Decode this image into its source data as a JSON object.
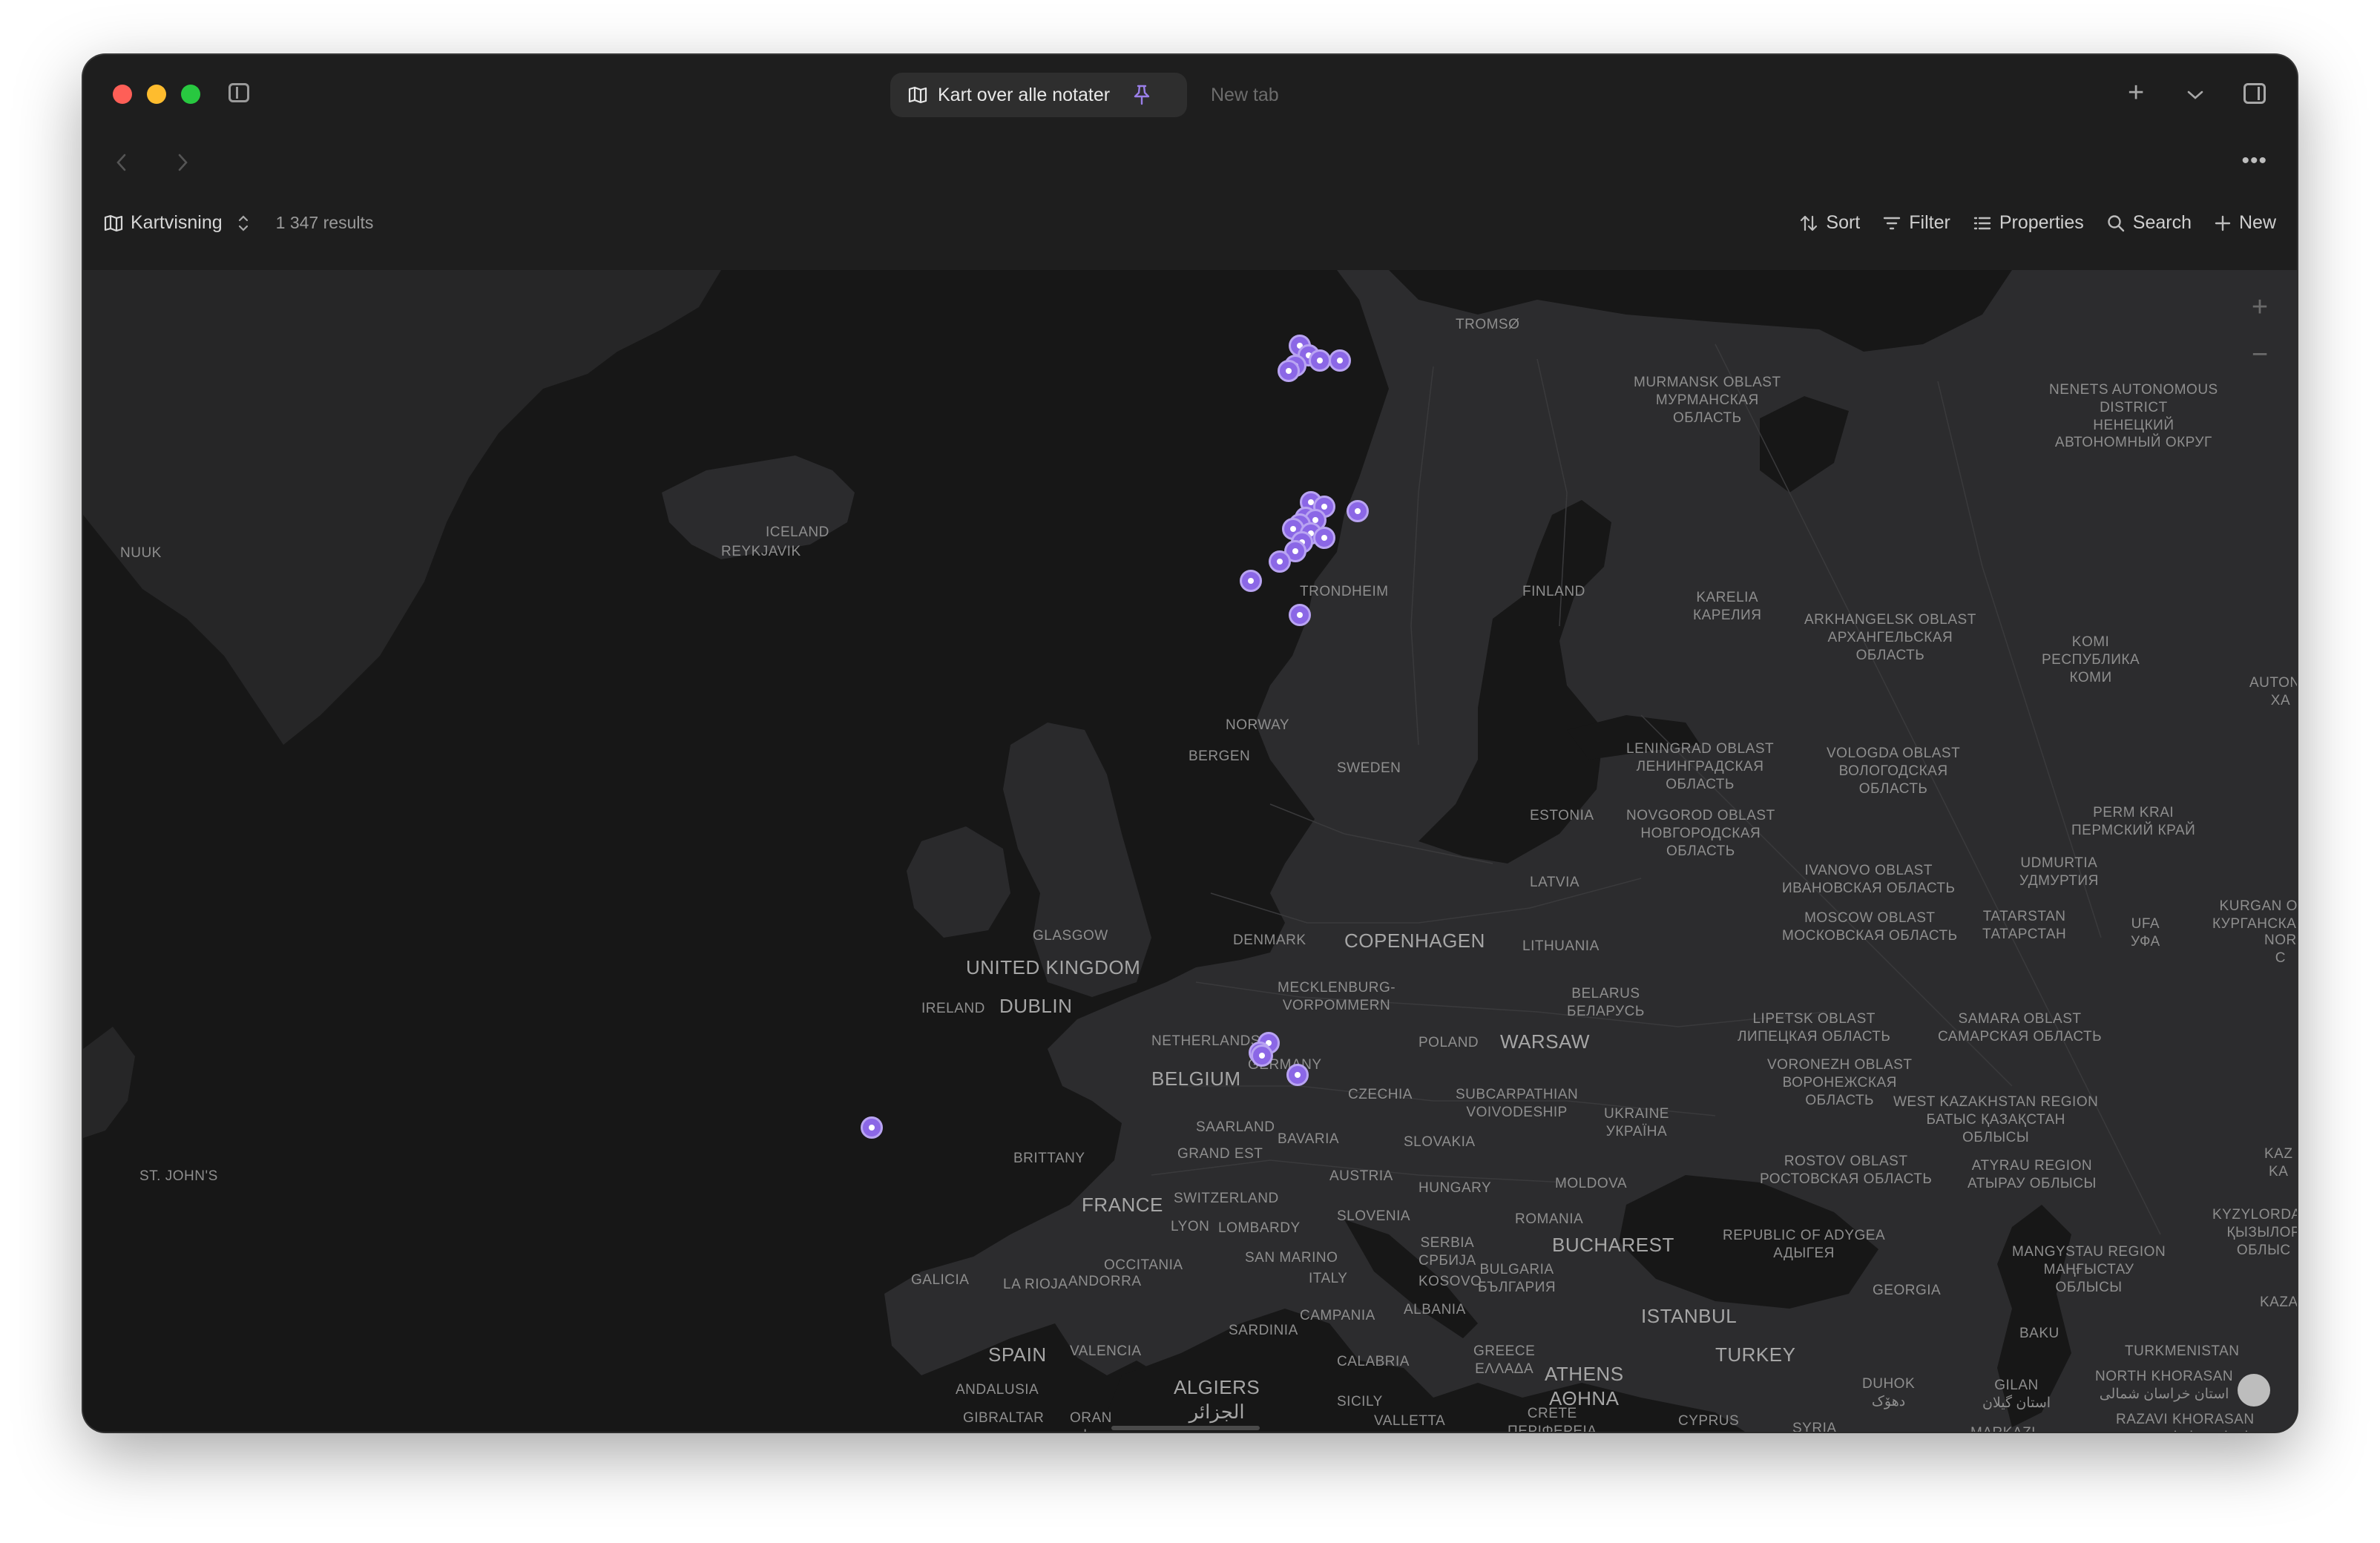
{
  "tabs": {
    "active_label": "Kart over alle notater",
    "inactive_label": "New tab"
  },
  "view": {
    "name": "Kartvisning",
    "results": "1 347 results"
  },
  "toolbar": {
    "sort": "Sort",
    "filter": "Filter",
    "properties": "Properties",
    "search": "Search",
    "new": "New"
  },
  "icons": {
    "tab": "map-icon",
    "pin": "pin-icon",
    "view": "map-icon",
    "view_switch": "chevron-updown-icon"
  },
  "colors": {
    "marker": "#8b67e6",
    "marker_ring": "#b9a4f2",
    "map_land": "#2a2a2c",
    "map_water": "#171717"
  },
  "map": {
    "labels": {
      "tromso": "TROMSØ",
      "murmansk": "MURMANSK OBLAST\nМУРМАНСКАЯ\nОБЛАСТЬ",
      "nenets": "NENETS AUTONOMOUS\nDISTRICT\nНЕНЕЦКИЙ\nАВТОНОМНЫЙ ОКРУГ",
      "iceland": "ICELAND",
      "reykjavik": "REYKJAVIK",
      "nuuk": "NUUK",
      "trondheim": "TRONDHEIM",
      "finland": "FINLAND",
      "karelia": "KARELIA\nКАРЕЛИЯ",
      "arkhangelsk": "ARKHANGELSK OBLAST\nАРХАНГЕЛЬСКАЯ\nОБЛАСТЬ",
      "komi": "KOMI\nРЕСПУБЛИКА\nКОМИ",
      "autono": "AUTONO\nXA",
      "norway": "NORWAY",
      "bergen": "BERGEN",
      "sweden": "SWEDEN",
      "leningrad": "LENINGRAD OBLAST\nЛЕНИНГРАДСКАЯ\nОБЛАСТЬ",
      "vologda": "VOLOGDA OBLAST\nВОЛОГОДСКАЯ\nОБЛАСТЬ",
      "perm": "PERM KRAI\nПЕРМСКИЙ КРАЙ",
      "estonia": "ESTONIA",
      "novgorod": "NOVGOROD OBLAST\nНОВГОРОДСКАЯ\nОБЛАСТЬ",
      "udmurtia": "UDMURTIA\nУДМУРТИЯ",
      "ivanovo": "IVANOVO OBLAST\nИВАНОВСКАЯ ОБЛАСТЬ",
      "latvia": "LATVIA",
      "kurgan": "KURGAN OBL\nКУРГАНСКАЯ О",
      "glasgow": "GLASGOW",
      "denmark": "DENMARK",
      "copenhagen": "COPENHAGEN",
      "lithuania": "LITHUANIA",
      "moscow": "MOSCOW OBLAST\nМОСКОВСКАЯ ОБЛАСТЬ",
      "tatarstan": "TATARSTAN\nТАТАРСТАН",
      "ufa": "UFA\nУФА",
      "nor": "NOR\nC",
      "united_kingdom": "UNITED KINGDOM",
      "mecklenburg": "MECKLENBURG-\nVORPOMMERN",
      "belarus": "BELARUS\nБЕЛАРУСЬ",
      "ireland": "IRELAND",
      "dublin": "DUBLIN",
      "lipetsk": "LIPETSK OBLAST\nЛИПЕЦКАЯ ОБЛАСТЬ",
      "samara": "SAMARA OBLAST\nСАМАРСКАЯ ОБЛАСТЬ",
      "netherlands": "NETHERLANDS",
      "poland": "POLAND",
      "warsaw": "WARSAW",
      "voronezh": "VORONEZH OBLAST\nВОРОНЕЖСКАЯ\nОБЛАСТЬ",
      "germany": "GERMANY",
      "belgium": "BELGIUM",
      "subcarpathian": "SUBCARPATHIAN\nVOIVODESHIP",
      "czechia": "CZECHIA",
      "west_kazakhstan": "WEST KAZAKHSTAN REGION\nБАТЫС ҚАЗАҚСТАН\nОБЛЫСЫ",
      "ukraine": "UKRAINE\nУКРАЇНА",
      "saarland": "SAARLAND",
      "bavaria": "BAVARIA",
      "grand_est": "GRAND EST",
      "slovakia": "SLOVAKIA",
      "brittany": "BRITTANY",
      "kaz": "KAZ\nKA",
      "austria": "AUSTRIA",
      "rostov": "ROSTOV OBLAST\nРОСТОВСКАЯ ОБЛАСТЬ",
      "atyrau": "ATYRAU REGION\nАТЫРАУ ОБЛЫСЫ",
      "st_johns": "ST. JOHN'S",
      "hungary": "HUNGARY",
      "moldova": "MOLDOVA",
      "switzerland": "SWITZERLAND",
      "france": "FRANCE",
      "slovenia": "SLOVENIA",
      "romania": "ROMANIA",
      "lyon": "LYON",
      "lombardy": "LOMBARDY",
      "kyzylorda": "KYZYLORDA R\nҚЫЗЫЛОР\nОБЛЫС",
      "adygea": "REPUBLIC OF ADYGEA\nАДЫГЕЯ",
      "serbia": "SERBIA\nСРБИЈА",
      "bucharest": "BUCHAREST",
      "san_marino": "SAN MARINO",
      "mangystau": "MANGYSTAU REGION\nМАҢҒЫСТАУ\nОБЛЫСЫ",
      "occitania": "OCCITANIA",
      "galicia": "GALICIA",
      "la_rioja": "LA RIOJA",
      "andorra": "ANDORRA",
      "italy": "ITALY",
      "kosovo": "KOSOVO",
      "bulgaria": "BULGARIA\nБЪЛГАРИЯ",
      "georgia": "GEORGIA",
      "albania": "ALBANIA",
      "campania": "CAMPANIA",
      "kazakhstan": "KAZAKHST",
      "istanbul": "ISTANBUL",
      "sardinia": "SARDINIA",
      "baku": "BAKU",
      "spain": "SPAIN",
      "valencia": "VALENCIA",
      "turkey": "TURKEY",
      "calabria": "CALABRIA",
      "turkmenistan": "TURKMENISTAN",
      "greece": "GREECE\nΕΛΛΑΔΑ",
      "athens": "ATHENS\nΑΘΗΝΑ",
      "north_khorasan": "NORTH KHORASAN\nاستان خراسان شمالی",
      "andalusia": "ANDALUSIA",
      "algiers": "ALGIERS\nالجزائر",
      "sicily": "SICILY",
      "duhok": "DUHOK\nدهۆک",
      "gilan": "GILAN\nاستان گیلان",
      "gibraltar": "GIBRALTAR",
      "oran": "ORAN\nوهران",
      "valletta": "VALLETTA",
      "crete": "CRETE\nΠΕΡΙΦΕΡΕΙΑ",
      "cyprus": "CYPRUS",
      "syria": "SYRIA",
      "markazi": "MARKAZI",
      "razavi": "RAZAVI KHORASAN\nاستان خراسان رضوی"
    },
    "markers": [
      {
        "lat": 69.65,
        "lon": 18.96
      },
      {
        "lat": 68.4,
        "lon": 15.0
      },
      {
        "lat": 67.9,
        "lon": 15.1
      },
      {
        "lat": 67.7,
        "lon": 15.5
      },
      {
        "lat": 63.6,
        "lon": 10.5
      },
      {
        "lat": 63.4,
        "lon": 10.9
      },
      {
        "lat": 63.3,
        "lon": 11.4
      },
      {
        "lat": 63.2,
        "lon": 10.3
      },
      {
        "lat": 63.3,
        "lon": 12.3
      },
      {
        "lat": 63.1,
        "lon": 10.0
      },
      {
        "lat": 60.3,
        "lon": 11.0
      },
      {
        "lat": 60.2,
        "lon": 11.6
      },
      {
        "lat": 60.1,
        "lon": 13.1
      },
      {
        "lat": 59.95,
        "lon": 10.75
      },
      {
        "lat": 59.9,
        "lon": 11.2
      },
      {
        "lat": 59.8,
        "lon": 10.5
      },
      {
        "lat": 59.7,
        "lon": 10.2
      },
      {
        "lat": 59.6,
        "lon": 11.0
      },
      {
        "lat": 59.5,
        "lon": 11.6
      },
      {
        "lat": 59.4,
        "lon": 10.6
      },
      {
        "lat": 59.2,
        "lon": 10.3
      },
      {
        "lat": 58.95,
        "lon": 9.6
      },
      {
        "lat": 58.5,
        "lon": 8.3
      },
      {
        "lat": 57.7,
        "lon": 10.5
      },
      {
        "lat": 45.9,
        "lon": 9.1
      },
      {
        "lat": 45.6,
        "lon": 8.7
      },
      {
        "lat": 45.5,
        "lon": 8.8
      },
      {
        "lat": 44.9,
        "lon": 10.4
      },
      {
        "lat": 43.2,
        "lon": -8.7
      }
    ]
  }
}
